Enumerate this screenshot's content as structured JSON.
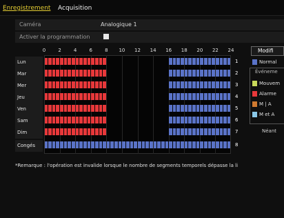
{
  "tabs": {
    "recording": "Enregistrement",
    "acquisition": "Acquisition"
  },
  "form": {
    "camera_label": "Caméra",
    "camera_value": "Analogique 1",
    "schedule_label": "Activer la programmation",
    "schedule_enabled": true
  },
  "schedule": {
    "hour_ticks": [
      "0",
      "2",
      "4",
      "6",
      "8",
      "10",
      "12",
      "14",
      "16",
      "18",
      "20",
      "22",
      "24"
    ],
    "days": [
      {
        "label": "Lun",
        "num": "1",
        "segments": [
          {
            "type": "alarm",
            "from": 0,
            "to": 8
          },
          {
            "type": "normal",
            "from": 16,
            "to": 24
          }
        ]
      },
      {
        "label": "Mar",
        "num": "2",
        "segments": [
          {
            "type": "alarm",
            "from": 0,
            "to": 8
          },
          {
            "type": "normal",
            "from": 16,
            "to": 24
          }
        ]
      },
      {
        "label": "Mer",
        "num": "3",
        "segments": [
          {
            "type": "alarm",
            "from": 0,
            "to": 8
          },
          {
            "type": "normal",
            "from": 16,
            "to": 24
          }
        ]
      },
      {
        "label": "Jeu",
        "num": "4",
        "segments": [
          {
            "type": "alarm",
            "from": 0,
            "to": 8
          },
          {
            "type": "normal",
            "from": 16,
            "to": 24
          }
        ]
      },
      {
        "label": "Ven",
        "num": "5",
        "segments": [
          {
            "type": "alarm",
            "from": 0,
            "to": 8
          },
          {
            "type": "normal",
            "from": 16,
            "to": 24
          }
        ]
      },
      {
        "label": "Sam",
        "num": "6",
        "segments": [
          {
            "type": "alarm",
            "from": 0,
            "to": 8
          },
          {
            "type": "normal",
            "from": 16,
            "to": 24
          }
        ]
      },
      {
        "label": "Dim",
        "num": "7",
        "segments": [
          {
            "type": "alarm",
            "from": 0,
            "to": 8
          },
          {
            "type": "normal",
            "from": 16,
            "to": 24
          }
        ]
      },
      {
        "label": "Congés",
        "num": "8",
        "segments": [
          {
            "type": "normal",
            "from": 0,
            "to": 24
          }
        ]
      }
    ]
  },
  "legend": {
    "modify_button": "Modifi",
    "events_title": "Événeme",
    "items": [
      {
        "name": "normal",
        "label": "Normal",
        "color": "#5a73c8"
      },
      {
        "name": "motion",
        "label": "Mouvem",
        "color": "#c8d85a"
      },
      {
        "name": "alarm",
        "label": "Alarme",
        "color": "#e8383a"
      },
      {
        "name": "motion-or-alarm",
        "label": "M | A",
        "color": "#d07a30"
      },
      {
        "name": "motion-and-alarm",
        "label": "M et A",
        "color": "#8ac8e8"
      }
    ],
    "none_label": "Néant"
  },
  "colors": {
    "normal": "#5a73c8",
    "alarm": "#e8383a",
    "active_tab": "#e8d034"
  },
  "remark": "*Remarque : l'opération est invalide lorsque le nombre de segments temporels dépasse la li"
}
